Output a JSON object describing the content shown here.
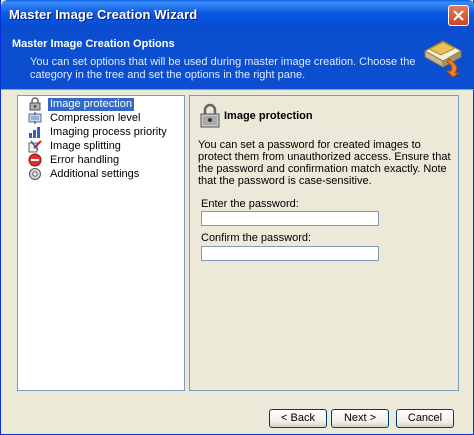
{
  "window": {
    "title": "Master Image Creation Wizard"
  },
  "header": {
    "title": "Master Image Creation Options",
    "description": "You can set options that will be used during master image creation. Choose the category in the tree and set the options in the right pane."
  },
  "tree": {
    "items": [
      {
        "label": "Image protection",
        "icon": "padlock-icon",
        "selected": true
      },
      {
        "label": "Compression level",
        "icon": "compression-icon",
        "selected": false
      },
      {
        "label": "Imaging process priority",
        "icon": "priority-icon",
        "selected": false
      },
      {
        "label": "Image splitting",
        "icon": "split-icon",
        "selected": false
      },
      {
        "label": "Error handling",
        "icon": "error-icon",
        "selected": false
      },
      {
        "label": "Additional settings",
        "icon": "settings-icon",
        "selected": false
      }
    ]
  },
  "panel": {
    "title": "Image protection",
    "description": "You can set a password for created images to protect them from unauthorized access. Ensure that the password and confirmation match exactly. Note that the password is case-sensitive.",
    "password_label": "Enter the password:",
    "password_value": "",
    "confirm_label": "Confirm the password:",
    "confirm_value": ""
  },
  "buttons": {
    "back": "< Back",
    "next": "Next >",
    "cancel": "Cancel"
  }
}
